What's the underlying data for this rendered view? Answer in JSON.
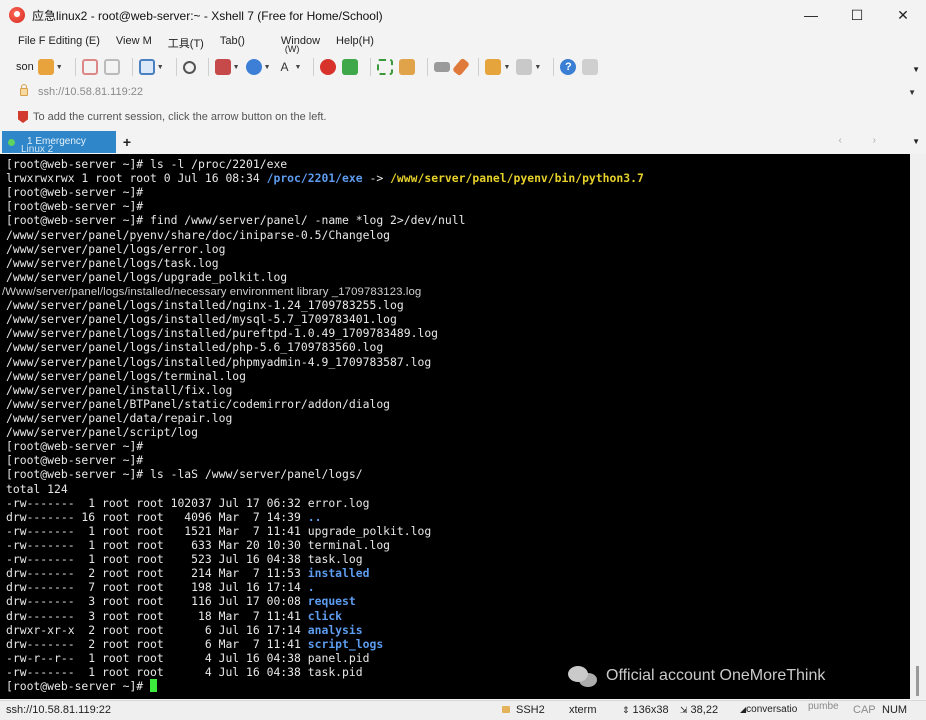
{
  "window": {
    "title": "应急linux2 - root@web-server:~ - Xshell 7 (Free for Home/School)",
    "minimize": "—",
    "maximize": "☐",
    "close": "✕"
  },
  "menu": {
    "items": [
      "File F Editing (E)",
      "View M",
      "工具(T)",
      "Tab()",
      "Window",
      "Help(H)"
    ],
    "window_small": "(W)"
  },
  "toolbar": {
    "session_label": "son"
  },
  "address": {
    "url": "ssh://10.58.81.119:22"
  },
  "hint": {
    "text": "To add the current session, click the arrow button on the left."
  },
  "tab": {
    "label_top": "1 Emergency",
    "label_bottom": "Linux 2",
    "add": "+",
    "nav": "‹ ›"
  },
  "terminal": {
    "lines": [
      [
        {
          "t": "[root@web-server ~]# ls -l /proc/2201/exe"
        }
      ],
      [
        {
          "t": "lrwxrwxrwx 1 root root 0 Jul 16 08:34 "
        },
        {
          "t": "/proc/2201/exe",
          "c": "c-blue"
        },
        {
          "t": " -> "
        },
        {
          "t": "/www/server/panel/pyenv/bin/python3.7",
          "c": "c-yellow"
        }
      ],
      [
        {
          "t": "[root@web-server ~]#"
        }
      ],
      [
        {
          "t": "[root@web-server ~]#"
        }
      ],
      [
        {
          "t": "[root@web-server ~]# find /www/server/panel/ -name *log 2>/dev/null"
        }
      ],
      [
        {
          "t": "/www/server/panel/pyenv/share/doc/iniparse-0.5/Changelog"
        }
      ],
      [
        {
          "t": "/www/server/panel/logs/error.log"
        }
      ],
      [
        {
          "t": "/www/server/panel/logs/task.log"
        }
      ],
      [
        {
          "t": "/www/server/panel/logs/upgrade_polkit.log"
        }
      ],
      [
        {
          "t": "/Www/server/panel/logs/installed/necessary environment library _1709783123.log",
          "c": "c-odd"
        }
      ],
      [
        {
          "t": "/www/server/panel/logs/installed/nginx-1.24_1709783255.log"
        }
      ],
      [
        {
          "t": "/www/server/panel/logs/installed/mysql-5.7_1709783401.log"
        }
      ],
      [
        {
          "t": "/www/server/panel/logs/installed/pureftpd-1.0.49_1709783489.log"
        }
      ],
      [
        {
          "t": "/www/server/panel/logs/installed/php-5.6_1709783560.log"
        }
      ],
      [
        {
          "t": "/www/server/panel/logs/installed/phpmyadmin-4.9_1709783587.log"
        }
      ],
      [
        {
          "t": "/www/server/panel/logs/terminal.log"
        }
      ],
      [
        {
          "t": "/www/server/panel/install/fix.log"
        }
      ],
      [
        {
          "t": "/www/server/panel/BTPanel/static/codemirror/addon/dialog"
        }
      ],
      [
        {
          "t": "/www/server/panel/data/repair.log"
        }
      ],
      [
        {
          "t": "/www/server/panel/script/log"
        }
      ],
      [
        {
          "t": "[root@web-server ~]#"
        }
      ],
      [
        {
          "t": "[root@web-server ~]#"
        }
      ],
      [
        {
          "t": "[root@web-server ~]# ls -laS /www/server/panel/logs/"
        }
      ],
      [
        {
          "t": "total 124"
        }
      ],
      [
        {
          "t": "-rw-------  1 root root 102037 Jul 17 06:32 error.log"
        }
      ],
      [
        {
          "t": "drw------- 16 root root   4096 Mar  7 14:39 "
        },
        {
          "t": "..",
          "c": "c-blue"
        }
      ],
      [
        {
          "t": "-rw-------  1 root root   1521 Mar  7 11:41 upgrade_polkit.log"
        }
      ],
      [
        {
          "t": "-rw-------  1 root root    633 Mar 20 10:30 terminal.log"
        }
      ],
      [
        {
          "t": "-rw-------  1 root root    523 Jul 16 04:38 task.log"
        }
      ],
      [
        {
          "t": "drw-------  2 root root    214 Mar  7 11:53 "
        },
        {
          "t": "installed",
          "c": "c-blue"
        }
      ],
      [
        {
          "t": "drw-------  7 root root    198 Jul 16 17:14 "
        },
        {
          "t": ".",
          "c": "c-blue"
        }
      ],
      [
        {
          "t": "drw-------  3 root root    116 Jul 17 00:08 "
        },
        {
          "t": "request",
          "c": "c-blue"
        }
      ],
      [
        {
          "t": "drw-------  3 root root     18 Mar  7 11:41 "
        },
        {
          "t": "click",
          "c": "c-blue"
        }
      ],
      [
        {
          "t": "drwxr-xr-x  2 root root      6 Jul 16 17:14 "
        },
        {
          "t": "analysis",
          "c": "c-blue"
        }
      ],
      [
        {
          "t": "drw-------  2 root root      6 Mar  7 11:41 "
        },
        {
          "t": "script_logs",
          "c": "c-blue"
        }
      ],
      [
        {
          "t": "-rw-r--r--  1 root root      4 Jul 16 04:38 panel.pid"
        }
      ],
      [
        {
          "t": "-rw-------  1 root root      4 Jul 16 04:38 task.pid"
        }
      ],
      [
        {
          "t": "[root@web-server ~]# "
        },
        {
          "t": "",
          "c": "cursor"
        }
      ]
    ]
  },
  "watermark": {
    "text": "Official account OneMoreThink"
  },
  "status": {
    "connection": "ssh://10.58.81.119:22",
    "protocol": "SSH2",
    "terminal_type": "xterm",
    "size": "136x38",
    "cursor_pos": "38,22",
    "session": "conversatio",
    "pumbe": "pumbe",
    "cap": "CAP",
    "num": "NUM"
  },
  "colors": {
    "tab_active": "#2f86c8",
    "terminal_bg": "#000000",
    "terminal_text": "#e8e8e8",
    "dir_blue": "#5d9cf0",
    "link_target_yellow": "#e6d12a",
    "cursor_green": "#3bea3b"
  }
}
